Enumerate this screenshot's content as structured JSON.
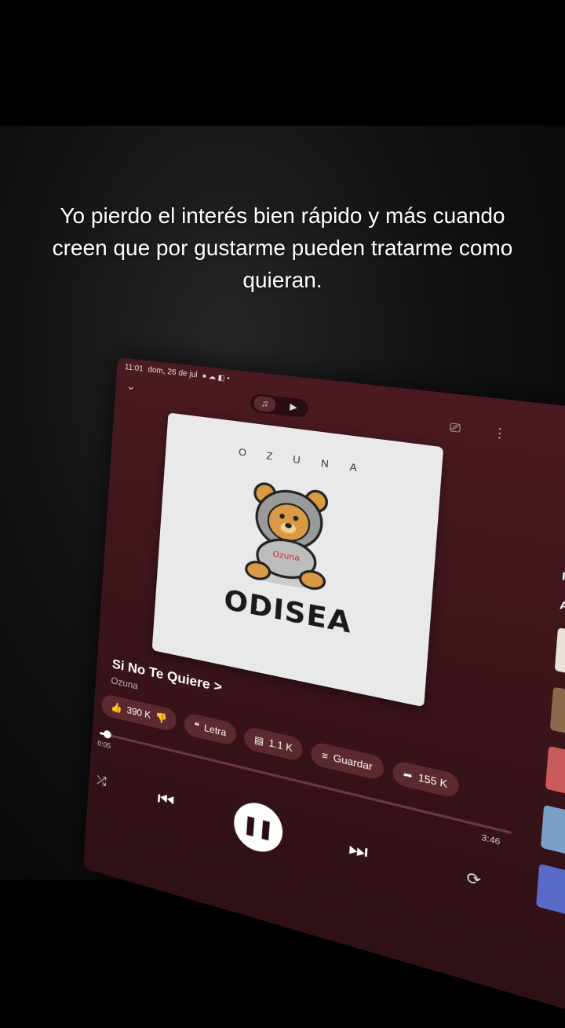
{
  "caption": "Yo pierdo el interés bien rápido y más cuando creen que por gustarme pueden tratarme como quieran.",
  "status": {
    "time": "11:01",
    "date": "dom, 26 de jul"
  },
  "album": {
    "letters": [
      "O",
      "Z",
      "U",
      "N",
      "A"
    ],
    "name": "ODISEA"
  },
  "song": {
    "title": "Si No Te Quiere",
    "arrow": ">",
    "artist": "Ozuna"
  },
  "chips": {
    "likes": "390 K",
    "lyrics": "Letra",
    "comments": "1.1 K",
    "save": "Guardar",
    "shares": "155 K"
  },
  "player": {
    "elapsed": "0:05",
    "duration": "3:46",
    "progress": 0.02
  },
  "side": {
    "letter_r": "R",
    "letter_ag": "Ag"
  },
  "colors": {
    "background": "#000000",
    "player_bg": "#3a141a",
    "chip": "#5a2a30"
  }
}
